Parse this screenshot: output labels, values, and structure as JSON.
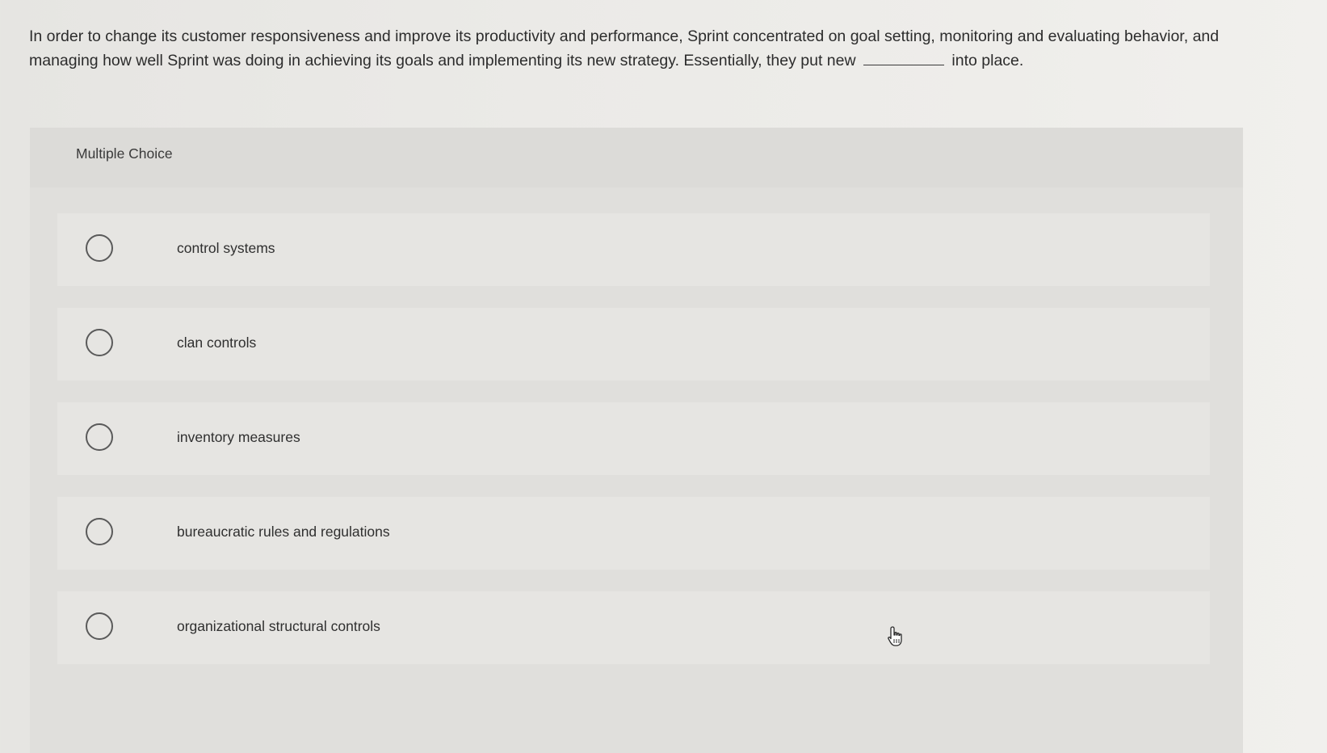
{
  "question": {
    "text_before": "In order to change its customer responsiveness and improve its productivity and performance, Sprint concentrated on goal setting, monitoring and evaluating behavior, and managing how well Sprint was doing in achieving its goals and implementing its new strategy. Essentially, they put new",
    "text_after": "into place."
  },
  "panel": {
    "title": "Multiple Choice"
  },
  "options": [
    {
      "label": "control systems"
    },
    {
      "label": "clan controls"
    },
    {
      "label": "inventory measures"
    },
    {
      "label": "bureaucratic rules and regulations"
    },
    {
      "label": "organizational structural controls"
    }
  ],
  "icons": {
    "cursor": "hand-pointer-icon",
    "radio": "radio-button-icon"
  }
}
